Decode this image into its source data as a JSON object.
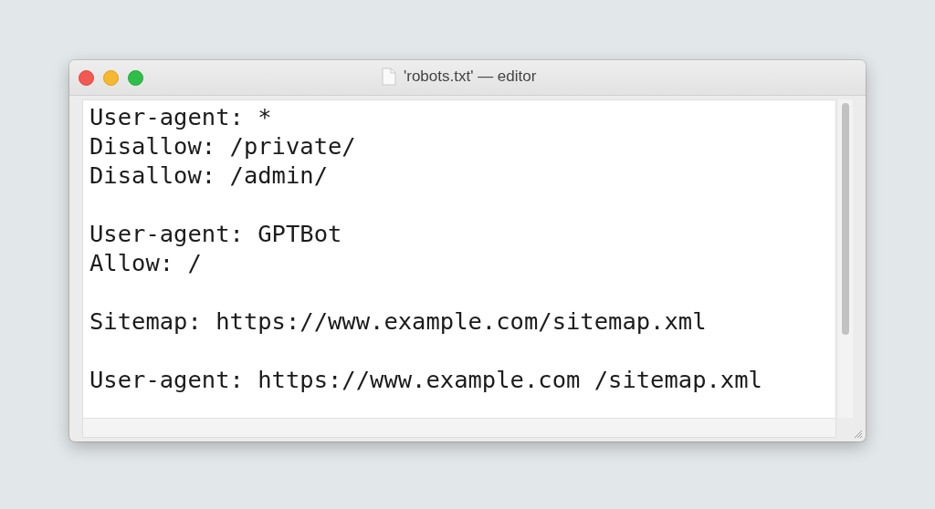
{
  "window": {
    "title": "'robots.txt' — editor"
  },
  "editor": {
    "blocks": [
      [
        "User-agent: *",
        "Disallow: /private/",
        "Disallow: /admin/"
      ],
      [
        "User-agent: GPTBot",
        "Allow: /"
      ],
      [
        "Sitemap: https://www.example.com/sitemap.xml"
      ],
      [
        "User-agent: https://www.example.com /sitemap.xml"
      ]
    ]
  }
}
